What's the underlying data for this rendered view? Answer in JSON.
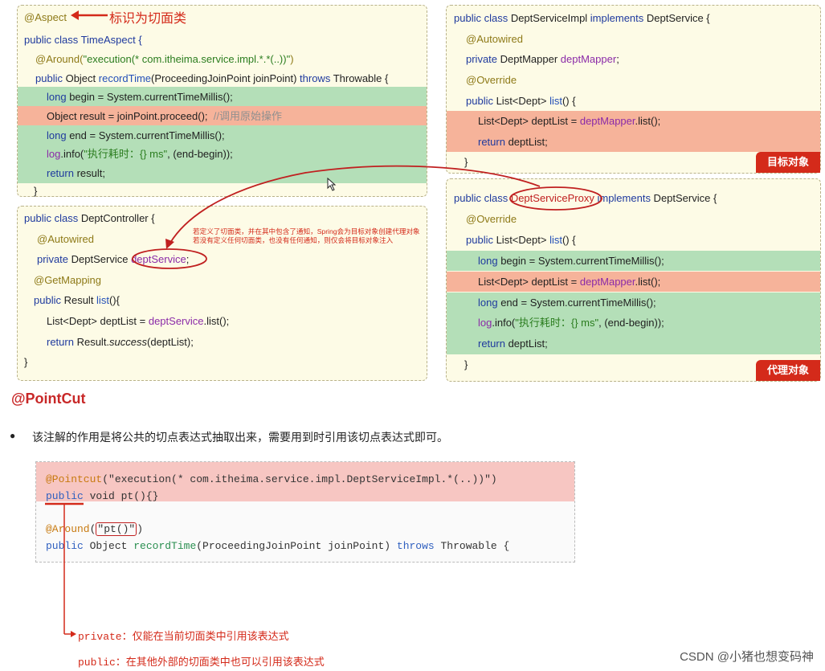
{
  "aspect_box": {
    "annotation": "@Aspect",
    "callout": "标识为切面类",
    "lines": {
      "l1": "public class TimeAspect {",
      "l2a": "@Around(",
      "l2b": "\"execution(* com.itheima.service.impl.*.*(..))\"",
      "l2c": ")",
      "l3a": "public",
      "l3b": " Object ",
      "l3c": "recordTime",
      "l3d": "(ProceedingJoinPoint joinPoint) ",
      "l3e": "throws",
      "l3f": " Throwable {",
      "l4a": "long",
      "l4b": " begin = System.currentTimeMillis();",
      "l5a": "Object result = joinPoint.proceed();  ",
      "l5b": "//调用原始操作",
      "l6a": "long",
      "l6b": " end = System.currentTimeMillis();",
      "l7a": "log",
      "l7b": ".info(",
      "l7c": "\"执行耗时：{} ms\"",
      "l7d": ", (end-begin));",
      "l8a": "return",
      "l8b": " result;",
      "l9": "}"
    }
  },
  "controller_box": {
    "l1a": "public class",
    "l1b": " DeptController {",
    "l2": "@Autowired",
    "l3a": "private",
    "l3b": " DeptService ",
    "l3c": "deptService",
    "l3d": ";",
    "l4": "@GetMapping",
    "l5a": "public",
    "l5b": " Result ",
    "l5c": "list",
    "l5d": "(){",
    "l6a": "List<Dept> deptList = ",
    "l6b": "deptService",
    "l6c": ".list();",
    "l7a": "return",
    "l7b": " Result.",
    "l7c": "success",
    "l7d": "(deptList);",
    "l8": "}"
  },
  "note": {
    "line1": "若定义了切面类，并在其中包含了通知，Spring会为目标对象创建代理对象",
    "line2": "若没有定义任何切面类，也没有任何通知，则仅会将目标对象注入"
  },
  "impl_box": {
    "l1a": "public class",
    "l1b": " DeptServiceImpl ",
    "l1c": "implements",
    "l1d": " DeptService {",
    "l2": "@Autowired",
    "l3a": "private",
    "l3b": " DeptMapper ",
    "l3c": "deptMapper",
    "l3d": ";",
    "l4": "@Override",
    "l5a": "public",
    "l5b": " List<Dept> ",
    "l5c": "list",
    "l5d": "() {",
    "l6a": "List<Dept> deptList = ",
    "l6b": "deptMapper",
    "l6c": ".list();",
    "l7a": "return",
    "l7b": " deptList;",
    "l8": "}",
    "tag": "目标对象"
  },
  "proxy_box": {
    "l1a": "public class ",
    "l1b": "DeptServiceProxy",
    "l1c": " implements",
    "l1d": " DeptService {",
    "l2": "@Override",
    "l3a": "public",
    "l3b": " List<Dept> ",
    "l3c": "list",
    "l3d": "() {",
    "l4a": "long",
    "l4b": " begin = System.currentTimeMillis();",
    "l5a": "List<Dept> deptList = ",
    "l5b": "deptMapper",
    "l5c": ".list();",
    "l6a": "long",
    "l6b": " end = System.currentTimeMillis();",
    "l7a": "log",
    "l7b": ".info(",
    "l7c": "\"执行耗时：{} ms\"",
    "l7d": ", (end-begin));",
    "l8a": "return",
    "l8b": " deptList;",
    "l9": "}",
    "tag": "代理对象"
  },
  "section": {
    "heading": "@PointCut",
    "bullet": "●",
    "text": "该注解的作用是将公共的切点表达式抽取出来，需要用到时引用该切点表达式即可。"
  },
  "code2": {
    "l1a": "@Pointcut",
    "l1b": "(\"execution(* com.itheima.service.impl.DeptServiceImpl.*(..))\")",
    "l2a": "public",
    "l2b": " void pt(){}",
    "l3a": "@Around",
    "l3b": "(",
    "l3c": "\"pt()\"",
    "l3d": ")",
    "l4a": "public",
    "l4b": " Object ",
    "l4c": "recordTime",
    "l4d": "(ProceedingJoinPoint joinPoint) ",
    "l4e": "throws",
    "l4f": " Throwable {"
  },
  "explain": {
    "private": "private：仅能在当前切面类中引用该表达式",
    "public": "public：在其他外部的切面类中也可以引用该表达式"
  },
  "watermark": "CSDN @小猪也想变码神",
  "colors": {
    "accent_red": "#d42a1a",
    "green_highlight": "#b4dfb8",
    "salmon_highlight": "#f6b39a",
    "code_bg": "#fdfbe6"
  }
}
